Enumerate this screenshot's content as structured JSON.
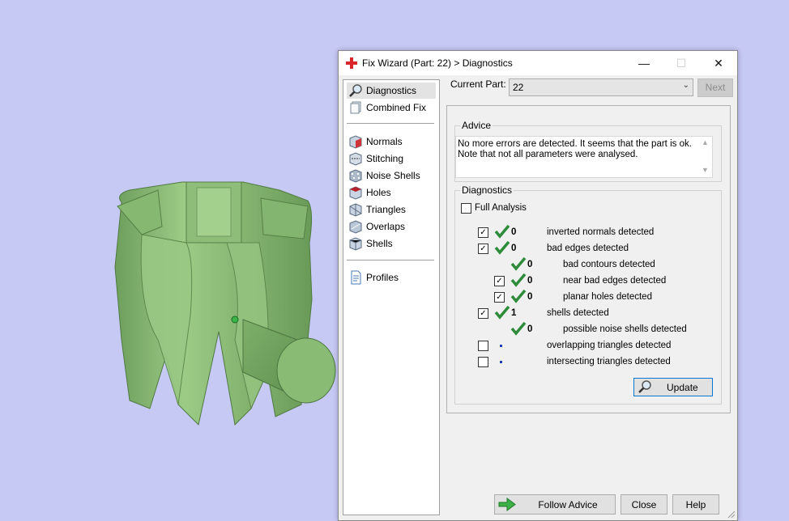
{
  "viewport": {
    "background": "#c7c9f5",
    "model_color": "#8fbe7a"
  },
  "dialog": {
    "title": "Fix Wizard (Part: 22) > Diagnostics",
    "controls": {
      "minimize": "—",
      "maximize": "☐",
      "close": "✕"
    }
  },
  "nav": {
    "items": [
      {
        "label": "Diagnostics",
        "icon": "magnifier-icon"
      },
      {
        "label": "Combined Fix",
        "icon": "layers-icon"
      },
      {
        "label": "Normals",
        "icon": "cube-red-face-icon"
      },
      {
        "label": "Stitching",
        "icon": "cube-stitch-icon"
      },
      {
        "label": "Noise Shells",
        "icon": "cube-dots-icon"
      },
      {
        "label": "Holes",
        "icon": "cube-hole-icon"
      },
      {
        "label": "Triangles",
        "icon": "cube-triangle-icon"
      },
      {
        "label": "Overlaps",
        "icon": "cube-overlap-icon"
      },
      {
        "label": "Shells",
        "icon": "cube-shell-icon"
      },
      {
        "label": "Profiles",
        "icon": "document-icon"
      }
    ]
  },
  "top": {
    "current_part_label": "Current Part:",
    "current_part_value": "22",
    "next_label": "Next"
  },
  "advice": {
    "title": "Advice",
    "line1": "No more errors are detected. It seems that the part is ok.",
    "line2": "Note that not all parameters were analysed."
  },
  "diagnostics": {
    "title": "Diagnostics",
    "full_analysis_label": "Full Analysis",
    "rows": [
      {
        "count": "0",
        "label": "inverted normals detected"
      },
      {
        "count": "0",
        "label": "bad edges detected"
      },
      {
        "count": "0",
        "label": "bad contours detected"
      },
      {
        "count": "0",
        "label": "near bad edges detected"
      },
      {
        "count": "0",
        "label": "planar holes detected"
      },
      {
        "count": "1",
        "label": "shells detected"
      },
      {
        "count": "0",
        "label": "possible noise shells detected"
      },
      {
        "count": "",
        "label": "overlapping triangles detected"
      },
      {
        "count": "",
        "label": "intersecting triangles detected"
      }
    ],
    "update_label": "Update"
  },
  "footer": {
    "follow_advice_label": "Follow Advice",
    "close_label": "Close",
    "help_label": "Help"
  }
}
